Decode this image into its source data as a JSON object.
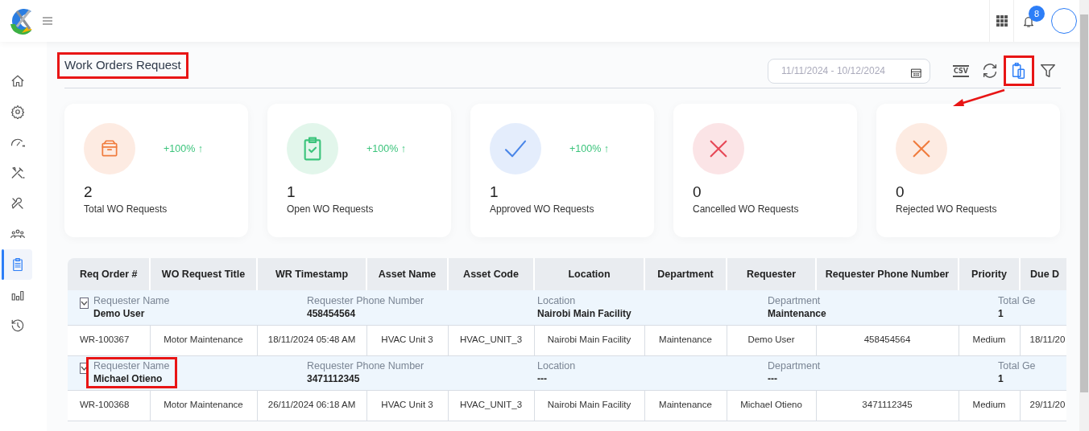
{
  "topbar": {
    "notification_count": "8"
  },
  "sidebar": {
    "items": [
      {
        "kind": "home",
        "selected": false
      },
      {
        "kind": "gear",
        "selected": false
      },
      {
        "kind": "gauge",
        "selected": false
      },
      {
        "kind": "tools",
        "selected": false
      },
      {
        "kind": "wrench",
        "selected": false
      },
      {
        "kind": "people",
        "selected": false
      },
      {
        "kind": "clipboard",
        "selected": true
      },
      {
        "kind": "chart",
        "selected": false
      },
      {
        "kind": "history",
        "selected": false
      }
    ]
  },
  "page": {
    "title": "Work Orders Request",
    "title_highlighted": true,
    "date_range": {
      "placeholder": "11/11/2024 - 10/12/2024"
    },
    "toolbar": [
      {
        "kind": "csv",
        "label": "CSV",
        "highlighted": false
      },
      {
        "kind": "refresh",
        "highlighted": false
      },
      {
        "kind": "copy",
        "highlighted": true
      },
      {
        "kind": "filter",
        "highlighted": false
      }
    ],
    "callout_arrow": true
  },
  "stats": [
    {
      "kind": "box",
      "color": "#f07c3e",
      "value": "2",
      "label": "Total WO Requests",
      "change": "+100% ↑"
    },
    {
      "kind": "clipboard",
      "color": "#3cc47c",
      "value": "1",
      "label": "Open WO Requests",
      "change": "+100% ↑"
    },
    {
      "kind": "check",
      "color": "#4a86e8",
      "value": "1",
      "label": "Approved WO Requests",
      "change": "+100% ↑"
    },
    {
      "kind": "cross",
      "color": "#e64857",
      "value": "0",
      "label": "Cancelled WO Requests"
    },
    {
      "kind": "cross",
      "color": "#f07c3e",
      "value": "0",
      "label": "Rejected WO Requests"
    }
  ],
  "table": {
    "columns": [
      "Req Order #",
      "WO Request Title",
      "WR Timestamp",
      "Asset Name",
      "Asset Code",
      "Location",
      "Department",
      "Requester",
      "Requester Phone Number",
      "Priority",
      "Due D"
    ],
    "groups": [
      {
        "expanded": true,
        "fields": [
          {
            "label": "Requester Name",
            "value": "Demo User",
            "highlighted": false
          },
          {
            "label": "Requester Phone Number",
            "value": "458454564",
            "highlighted": false
          },
          {
            "label": "Location",
            "value": "Nairobi Main Facility",
            "highlighted": false
          },
          {
            "label": "Department",
            "value": "Maintenance",
            "highlighted": false
          },
          {
            "label": "Total Ge",
            "value": "1",
            "highlighted": false
          }
        ],
        "rows": [
          [
            "WR-100367",
            "Motor Maintenance",
            "18/11/2024 05:48 AM",
            "HVAC Unit 3",
            "HVAC_UNIT_3",
            "Nairobi Main Facility",
            "Maintenance",
            "Demo User",
            "458454564",
            "Medium",
            "18/11/20"
          ]
        ]
      },
      {
        "expanded": true,
        "fields": [
          {
            "label": "Requester Name",
            "value": "Michael Otieno",
            "highlighted": true
          },
          {
            "label": "Requester Phone Number",
            "value": "3471112345",
            "highlighted": false
          },
          {
            "label": "Location",
            "value": "---",
            "highlighted": false
          },
          {
            "label": "Department",
            "value": "---",
            "highlighted": false
          },
          {
            "label": "Total Ge",
            "value": "1",
            "highlighted": false
          }
        ],
        "rows": [
          [
            "WR-100368",
            "Motor Maintenance",
            "26/11/2024 06:18 AM",
            "HVAC Unit 3",
            "HVAC_UNIT_3",
            "Nairobi Main Facility",
            "Maintenance",
            "Michael Otieno",
            "3471112345",
            "Medium",
            "29/11/20"
          ]
        ]
      }
    ]
  }
}
